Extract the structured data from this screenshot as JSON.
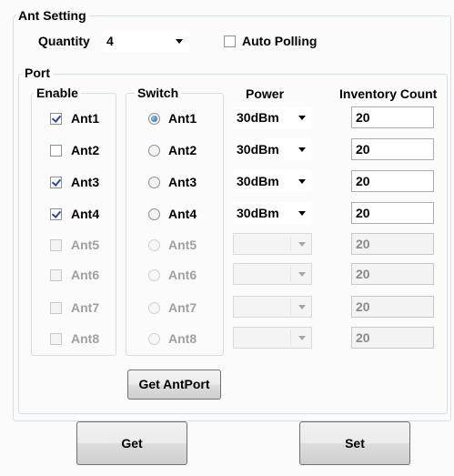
{
  "ant_setting": {
    "title": "Ant Setting",
    "quantity_label": "Quantity",
    "quantity_value": "4",
    "auto_polling_label": "Auto Polling",
    "auto_polling_checked": false
  },
  "port": {
    "title": "Port",
    "headers": {
      "enable": "Enable",
      "switch": "Switch",
      "power": "Power",
      "inventory_count": "Inventory Count"
    },
    "rows": [
      {
        "enable_label": "Ant1",
        "enable_checked": true,
        "switch_label": "Ant1",
        "switch_selected": true,
        "power": "30dBm",
        "count": "20",
        "active": true
      },
      {
        "enable_label": "Ant2",
        "enable_checked": false,
        "switch_label": "Ant2",
        "switch_selected": false,
        "power": "30dBm",
        "count": "20",
        "active": true
      },
      {
        "enable_label": "Ant3",
        "enable_checked": true,
        "switch_label": "Ant3",
        "switch_selected": false,
        "power": "30dBm",
        "count": "20",
        "active": true
      },
      {
        "enable_label": "Ant4",
        "enable_checked": true,
        "switch_label": "Ant4",
        "switch_selected": false,
        "power": "30dBm",
        "count": "20",
        "active": true
      },
      {
        "enable_label": "Ant5",
        "enable_checked": false,
        "switch_label": "Ant5",
        "switch_selected": false,
        "power": "",
        "count": "20",
        "active": false
      },
      {
        "enable_label": "Ant6",
        "enable_checked": false,
        "switch_label": "Ant6",
        "switch_selected": false,
        "power": "",
        "count": "20",
        "active": false
      },
      {
        "enable_label": "Ant7",
        "enable_checked": false,
        "switch_label": "Ant7",
        "switch_selected": false,
        "power": "",
        "count": "20",
        "active": false
      },
      {
        "enable_label": "Ant8",
        "enable_checked": false,
        "switch_label": "Ant8",
        "switch_selected": false,
        "power": "",
        "count": "20",
        "active": false
      }
    ],
    "get_antport_label": "Get AntPort"
  },
  "buttons": {
    "get_label": "Get",
    "set_label": "Set"
  }
}
